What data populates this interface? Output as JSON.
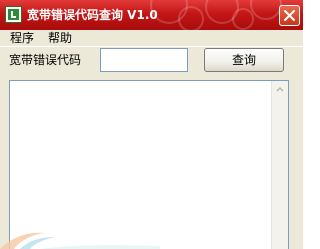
{
  "window": {
    "title": "宽带错误代码查询 V1.0",
    "app_icon": "green-app-icon",
    "close_icon": "close-icon"
  },
  "menu": {
    "items": [
      {
        "label": "程序"
      },
      {
        "label": "帮助"
      }
    ]
  },
  "query": {
    "label": "宽带错误代码",
    "input_value": "",
    "input_placeholder": "",
    "button_label": "查询"
  },
  "result": {
    "text": ""
  },
  "colors": {
    "titlebar": "#c41616",
    "window_bg": "#ece9d8",
    "input_border": "#7f9db9"
  }
}
